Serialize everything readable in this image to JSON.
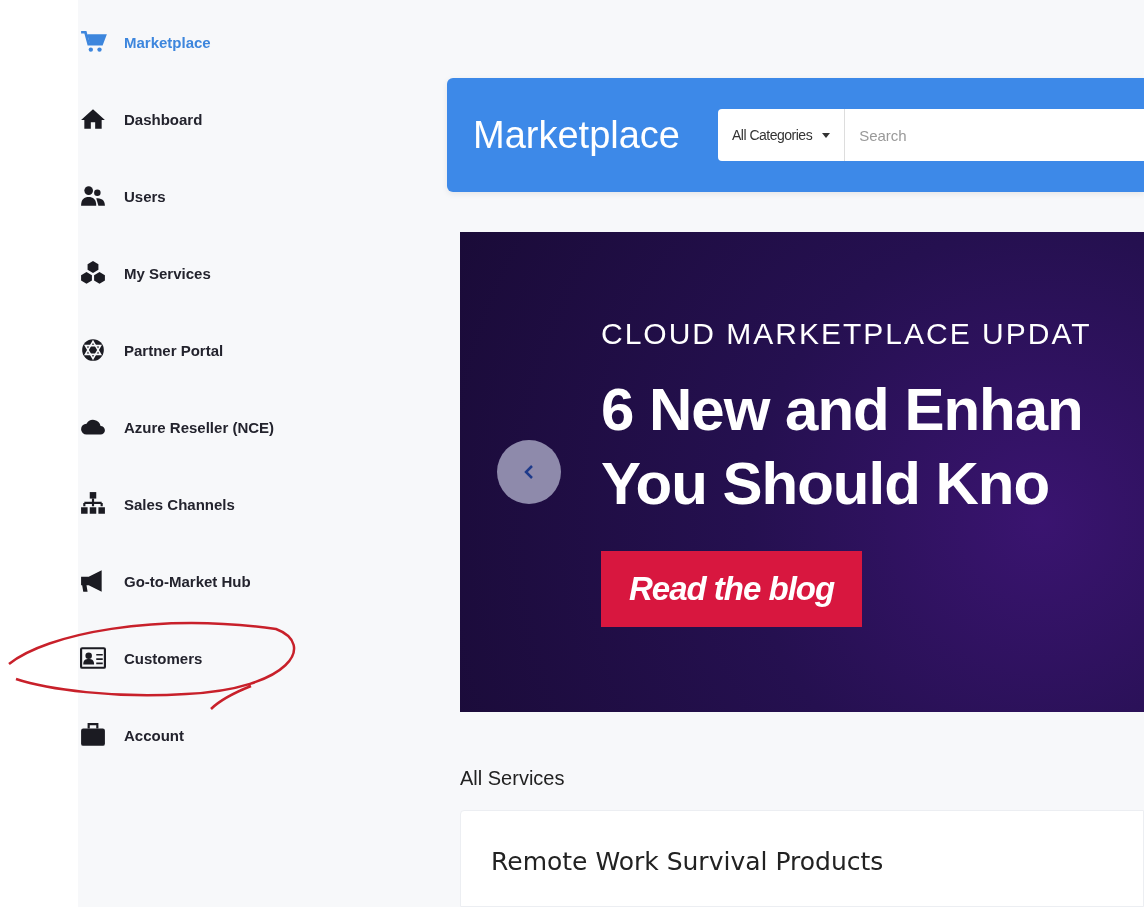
{
  "sidebar": {
    "items": [
      {
        "label": "Marketplace",
        "selected": true,
        "circled": false
      },
      {
        "label": "Dashboard",
        "selected": false,
        "circled": false
      },
      {
        "label": "Users",
        "selected": false,
        "circled": false
      },
      {
        "label": "My Services",
        "selected": false,
        "circled": false
      },
      {
        "label": "Partner Portal",
        "selected": false,
        "circled": false
      },
      {
        "label": "Azure Reseller (NCE)",
        "selected": false,
        "circled": false
      },
      {
        "label": "Sales Channels",
        "selected": false,
        "circled": false
      },
      {
        "label": "Go-to-Market Hub",
        "selected": false,
        "circled": false
      },
      {
        "label": "Customers",
        "selected": false,
        "circled": true
      },
      {
        "label": "Account",
        "selected": false,
        "circled": false
      }
    ]
  },
  "header": {
    "title": "Marketplace",
    "category": "All Categories",
    "search": {
      "placeholder": "Search"
    }
  },
  "banner": {
    "kicker": "CLOUD MARKETPLACE UPDAT",
    "headline": [
      "6 New and Enhan",
      "You Should Kno"
    ],
    "button": "Read the blog"
  },
  "section": {
    "title": "All Services",
    "card_title": "Remote Work Survival Products"
  }
}
